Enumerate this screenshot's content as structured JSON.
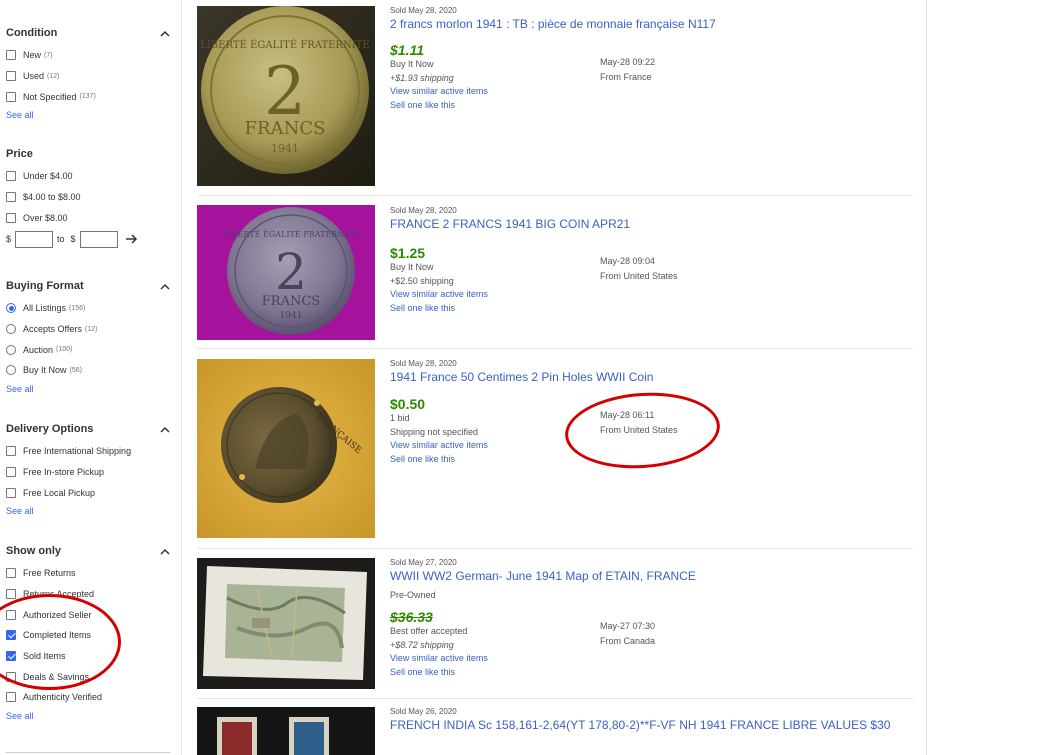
{
  "sidebar": {
    "condition": {
      "title": "Condition",
      "options": [
        {
          "label": "New",
          "count": "(7)"
        },
        {
          "label": "Used",
          "count": "(12)"
        },
        {
          "label": "Not Specified",
          "count": "(137)"
        }
      ],
      "see_all": "See all"
    },
    "price": {
      "title": "Price",
      "options": [
        {
          "label": "Under $4.00"
        },
        {
          "label": "$4.00 to $8.00"
        },
        {
          "label": "Over $8.00"
        }
      ],
      "range_currency": "$",
      "range_to": "to"
    },
    "buying_format": {
      "title": "Buying Format",
      "options": [
        {
          "label": "All Listings",
          "count": "(156)",
          "selected": true
        },
        {
          "label": "Accepts Offers",
          "count": "(12)"
        },
        {
          "label": "Auction",
          "count": "(100)"
        },
        {
          "label": "Buy It Now",
          "count": "(56)"
        }
      ],
      "see_all": "See all"
    },
    "delivery": {
      "title": "Delivery Options",
      "options": [
        {
          "label": "Free International Shipping"
        },
        {
          "label": "Free In-store Pickup"
        },
        {
          "label": "Free Local Pickup"
        }
      ],
      "see_all": "See all"
    },
    "show_only": {
      "title": "Show only",
      "options": [
        {
          "label": "Free Returns",
          "checked": false
        },
        {
          "label": "Returns Accepted",
          "checked": false
        },
        {
          "label": "Authorized Seller",
          "checked": false
        },
        {
          "label": "Completed Items",
          "checked": true
        },
        {
          "label": "Sold Items",
          "checked": true
        },
        {
          "label": "Deals & Savings",
          "checked": false
        },
        {
          "label": "Authenticity Verified",
          "checked": false
        }
      ],
      "see_all": "See all"
    }
  },
  "items": [
    {
      "sold": "Sold May 28, 2020",
      "title": "2 francs morlon 1941 : TB : pièce de monnaie française N117",
      "price": "$1.11",
      "format": "Buy It Now",
      "shipping": "+$1.93 shipping",
      "view_similar": "View similar active items",
      "sell_one": "Sell one like this",
      "date": "May-28 09:22",
      "from": "From France"
    },
    {
      "sold": "Sold May 28, 2020",
      "title": "FRANCE 2 FRANCS 1941 BIG COIN APR21",
      "price": "$1.25",
      "format": "Buy It Now",
      "shipping": "+$2.50 shipping",
      "view_similar": "View similar active items",
      "sell_one": "Sell one like this",
      "date": "May-28 09:04",
      "from": "From United States"
    },
    {
      "sold": "Sold May 28, 2020",
      "title": "1941 France 50 Centimes 2 Pin Holes WWII Coin",
      "price": "$0.50",
      "format": "1 bid",
      "shipping": "Shipping not specified",
      "view_similar": "View similar active items",
      "sell_one": "Sell one like this",
      "date": "May-28 06:11",
      "from": "From United States"
    },
    {
      "sold": "Sold May 27, 2020",
      "title": "WWII WW2 German- June 1941 Map of ETAIN, FRANCE",
      "subtitle": "Pre-Owned",
      "price": "$36.33",
      "format": "Best offer accepted",
      "shipping": "+$8.72 shipping",
      "view_similar": "View similar active items",
      "sell_one": "Sell one like this",
      "date": "May-27 07:30",
      "from": "From Canada"
    },
    {
      "sold": "Sold May 26, 2020",
      "title": "FRENCH INDIA Sc 158,161-2,64(YT 178,80-2)**F-VF NH 1941 FRANCE LIBRE VALUES $30"
    }
  ],
  "coin_texts": {
    "coin1": {
      "denom": "2",
      "unit": "FRANCS",
      "year": "1941",
      "legend": "LIBERTÉ ÉGALITÉ FRATERNITÉ"
    },
    "coin2": {
      "denom": "2",
      "unit": "FRANCS",
      "year": "1941",
      "legend": "LIBERTÉ ÉGALITÉ FRATERNITÉ"
    },
    "coin3": {
      "legend": "FRANÇAISE"
    }
  },
  "colors": {
    "link": "#3a5fc6",
    "price": "#2e8b00",
    "checkbox_accent": "#3665f3",
    "annotation": "#d40000"
  }
}
